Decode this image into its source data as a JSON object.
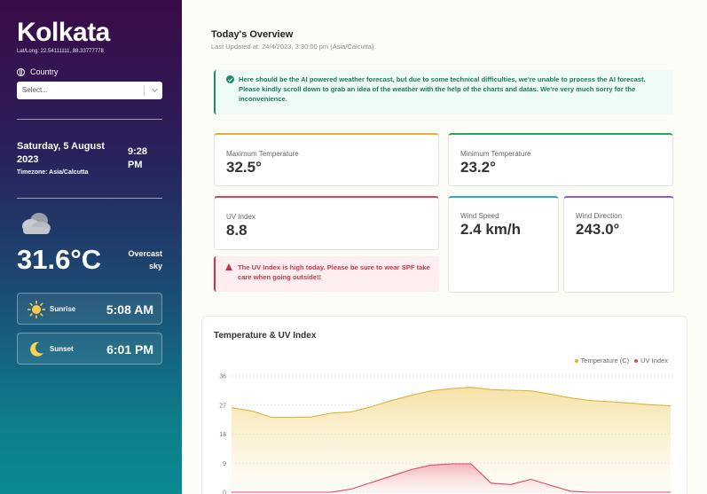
{
  "sidebar": {
    "city": "Kolkata",
    "latlong": "Lat/Long: 22.54111111, 88.33777778",
    "country_label": "Country",
    "country_select": "Select...",
    "date": "Saturday, 5 August 2023",
    "time": "9:28 PM",
    "timezone": "Timezone: Asia/Calcutta",
    "temperature": "31.6°C",
    "condition": "Overcast sky",
    "sunrise_label": "Sunrise",
    "sunrise_time": "5:08 AM",
    "sunset_label": "Sunset",
    "sunset_time": "6:01 PM"
  },
  "overview": {
    "title": "Today's Overview",
    "last_updated": "Last Updated at: 24/4/2023, 3:30:00 pm (Asia/Calcutta)",
    "notice": "Here should be the AI powered weather forecast, but due to some technical difficulties, we're unable to process the AI forecast. Please kindly scroll down to grab an idea of the weather with the help of the charts and datas. We're very much sorry for the inconvenience.",
    "uv_warning": "The UV Index is high today. Please be sure to wear SPF take care when going outside!!"
  },
  "cards": {
    "max_temp_label": "Maximum Temperature",
    "max_temp_value": "32.5°",
    "min_temp_label": "Minimum Temperature",
    "min_temp_value": "23.2°",
    "uv_label": "UV Index",
    "uv_value": "8.8",
    "wind_speed_label": "Wind Speed",
    "wind_speed_value": "2.4 km/h",
    "wind_dir_label": "Wind Direction",
    "wind_dir_value": "243.0°"
  },
  "colors": {
    "max_temp_accent": "#e0b23a",
    "min_temp_accent": "#27a35a",
    "uv_accent": "#d6455c",
    "wind_speed_accent": "#2ba8d6",
    "wind_dir_accent": "#8a5cd6",
    "temperature_series": "#e0b23a",
    "uv_series": "#e0455c"
  },
  "chart_data": {
    "type": "area",
    "title": "Temperature & UV Index",
    "ylim": [
      0,
      36
    ],
    "yticks": [
      0,
      9,
      18,
      27,
      36
    ],
    "grid": true,
    "legend_position": "top-right",
    "series": [
      {
        "name": "Temperature (C)",
        "values": [
          26.2,
          25.2,
          23.2,
          23.2,
          23.3,
          24.5,
          24.9,
          26.5,
          28.4,
          30.0,
          31.4,
          32.1,
          32.5,
          31.8,
          31.6,
          31.4,
          30.4,
          29.2,
          28.4,
          28.0,
          27.6,
          27.1,
          26.8
        ]
      },
      {
        "name": "UV Index",
        "values": [
          0,
          0,
          0,
          0,
          0,
          0,
          1,
          3,
          5,
          7,
          8.4,
          8.8,
          8.8,
          2.8,
          2.4,
          4.0,
          2.1,
          0.3,
          0,
          0,
          0,
          0,
          0
        ]
      }
    ]
  }
}
